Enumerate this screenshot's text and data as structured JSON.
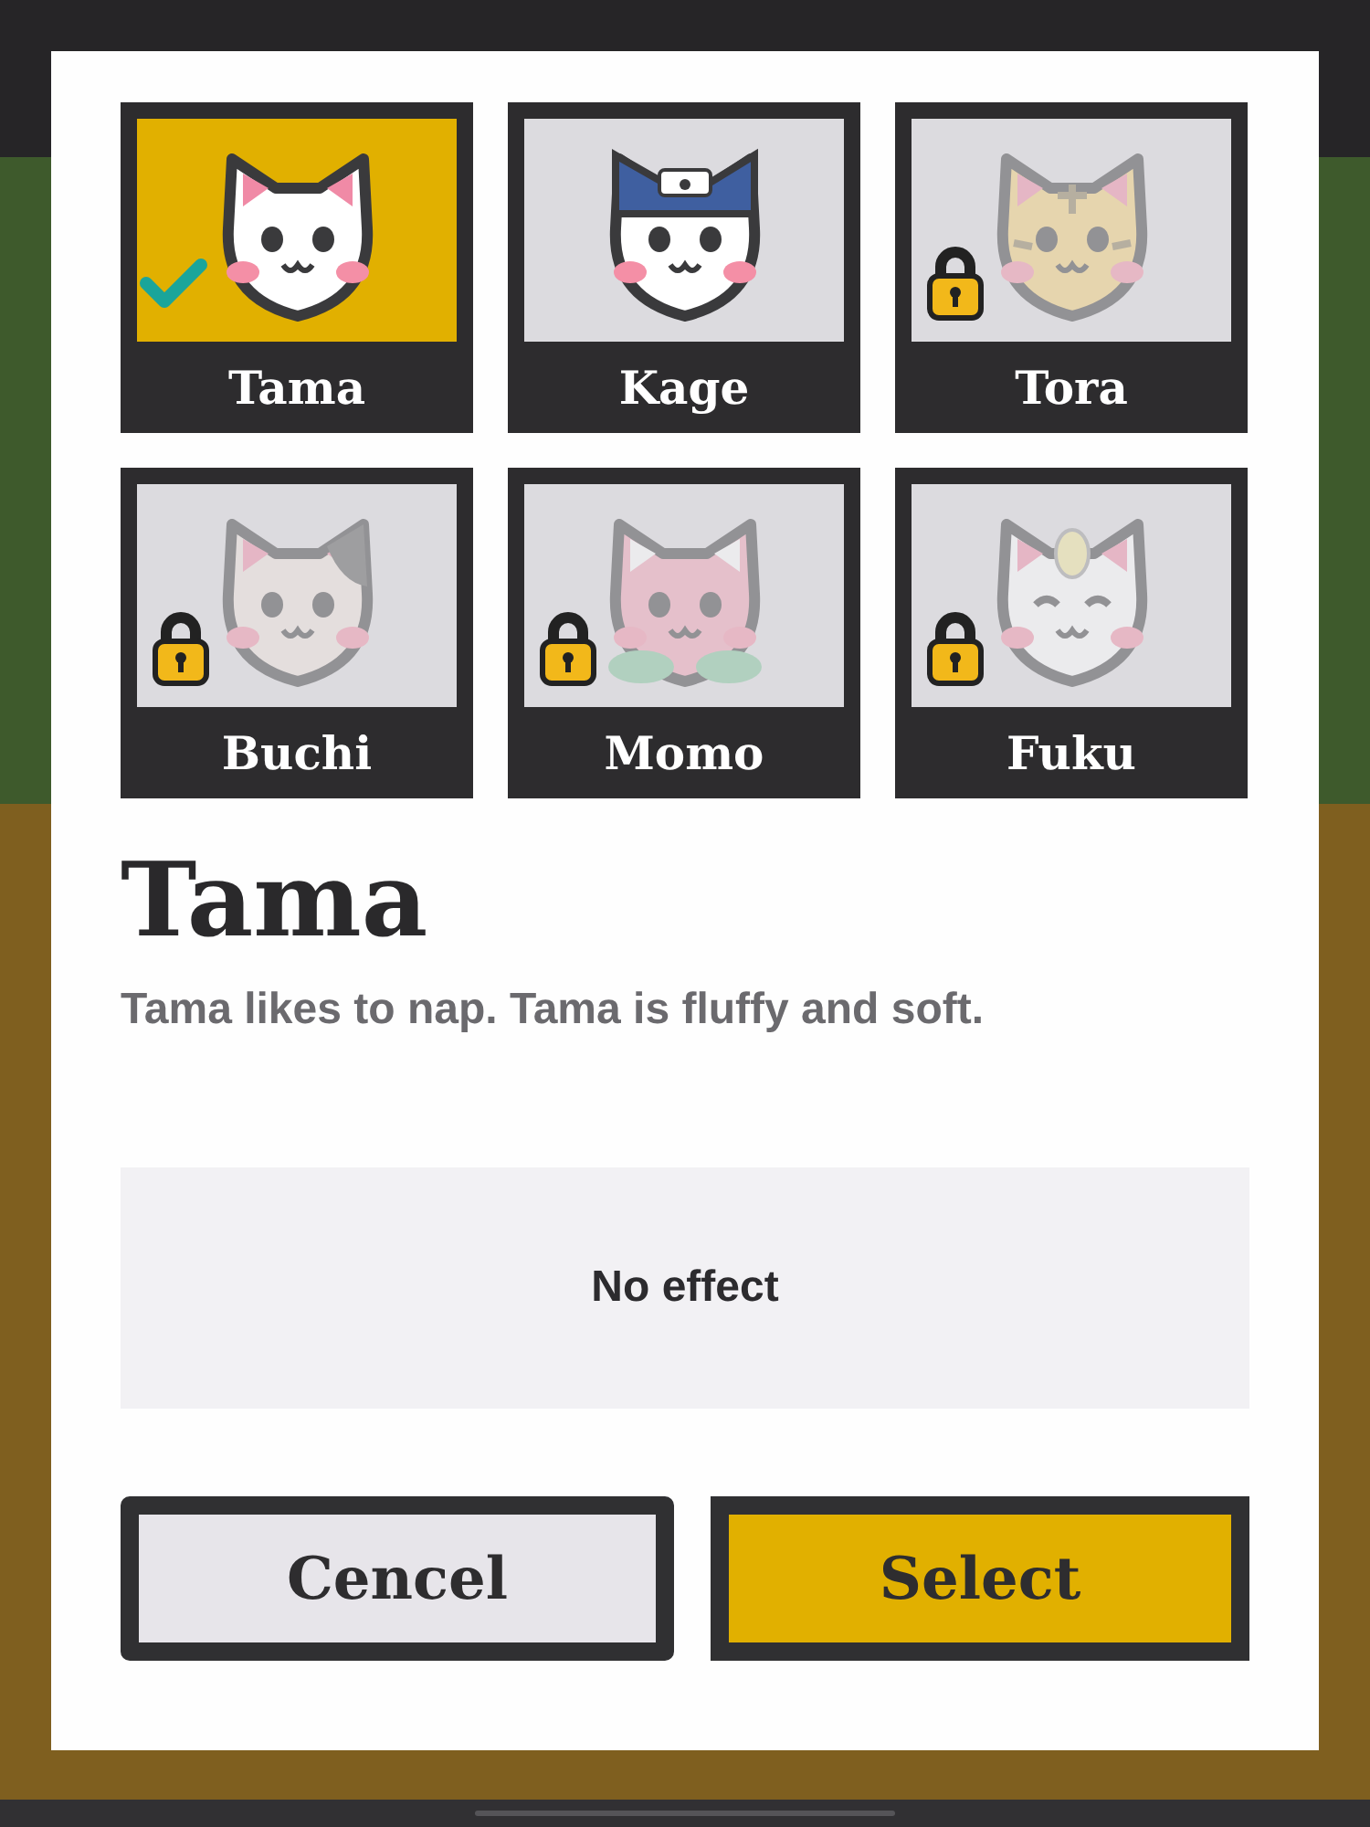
{
  "characters": [
    {
      "name": "Tama",
      "kind": "plain",
      "selected": true,
      "locked": false
    },
    {
      "name": "Kage",
      "kind": "ninja",
      "selected": false,
      "locked": false
    },
    {
      "name": "Tora",
      "kind": "tiger",
      "selected": false,
      "locked": true
    },
    {
      "name": "Buchi",
      "kind": "spotted",
      "selected": false,
      "locked": true
    },
    {
      "name": "Momo",
      "kind": "leafy",
      "selected": false,
      "locked": true
    },
    {
      "name": "Fuku",
      "kind": "lucky",
      "selected": false,
      "locked": true
    }
  ],
  "detail": {
    "title": "Tama",
    "description": "Tama likes to nap. Tama is fluffy and soft.",
    "effect": "No effect"
  },
  "buttons": [
    {
      "label": "Cencel",
      "kind": "secondary"
    },
    {
      "label": "Select",
      "kind": "primary"
    }
  ]
}
